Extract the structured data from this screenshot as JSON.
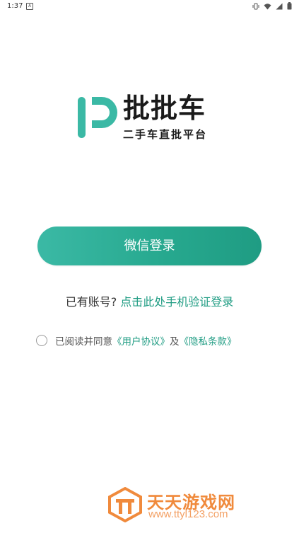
{
  "status_bar": {
    "time": "1:37",
    "notification_glyph": "A",
    "icons": [
      "vibrate-icon",
      "wifi-icon",
      "signal-icon",
      "battery-icon"
    ]
  },
  "brand": {
    "name": "批批车",
    "tagline": "二手车直批平台",
    "accent_color": "#27a98f"
  },
  "login": {
    "wechat_button_label": "微信登录",
    "phone_prompt": "已有账号?",
    "phone_link": "点击此处手机验证登录"
  },
  "agreement": {
    "prefix": "已阅读并同意",
    "user_agreement": "《用户协议》",
    "connector": "及",
    "privacy_policy": "《隐私条款》",
    "checked": false
  },
  "watermark": {
    "title": "天天游戏网",
    "url": "www.ttyl123.com"
  }
}
